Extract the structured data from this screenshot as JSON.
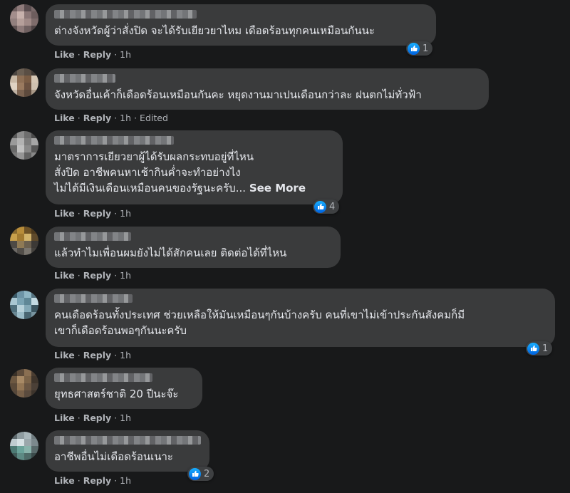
{
  "actions": {
    "like": "Like",
    "reply": "Reply",
    "separator": "·",
    "edited": "Edited"
  },
  "comments": [
    {
      "text": "ต่างจังหวัดผู้ว่าสั่งปิด จะได้รับเยียวยาไหม เดือดร้อนทุกคนเหมือนกันนะ",
      "time": "1h",
      "reactions": "1"
    },
    {
      "text": "จังหวัดอื่นเค้าก็เดือดร้อนเหมือนกันคะ หยุดงานมาเปนเดือนกว่าละ ฝนตกไม่ทั่วฟ้า",
      "time": "1h",
      "edited": true
    },
    {
      "text": "มาตราการเยียวยาผู้ได้รับผลกระทบอยู่ที่ไหน\nสั่งปิด อาชีพคนหาเช้ากินค่ำจะทำอย่างไง\nไม่ได้มีเงินเดือนเหมือนคนของรัฐนะครับ...",
      "see_more": "See More",
      "time": "1h",
      "reactions": "4"
    },
    {
      "text": "แล้วทำไมเพื่อนผมยังไม่ได้สักคนเลย ติดต่อได้ที่ไหน",
      "time": "1h"
    },
    {
      "text": "คนเดือดร้อนทั้งประเทศ ช่วยเหลือให้มันเหมือนๆกันบ้างครับ คนที่เขาไม่เข้าประกันสังคมก็มี\nเขาก็เดือดร้อนพอๆกันนะครับ",
      "time": "1h",
      "reactions": "1"
    },
    {
      "text": "ยุทธศาสตร์ชาติ 20 ปีนะจ๊ะ",
      "time": "1h"
    },
    {
      "text": "อาชีพอื่นไม่เดือดร้อนเนาะ",
      "time": "1h",
      "reactions": "2"
    }
  ],
  "colors": {
    "background": "#18191a",
    "bubble": "#3a3b3c",
    "text": "#e4e6eb",
    "meta": "#b0b3b8",
    "like_blue": "#1877f2"
  }
}
